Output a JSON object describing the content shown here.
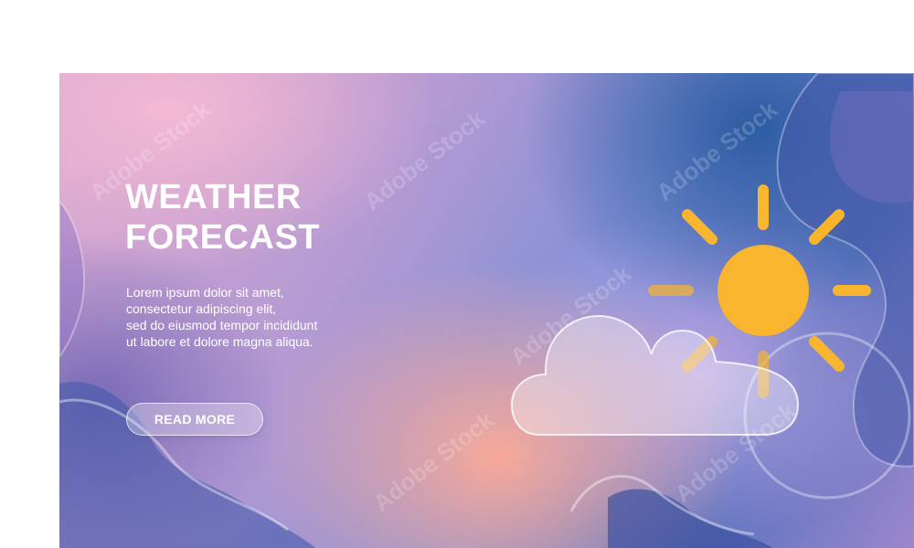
{
  "banner": {
    "title_lines": [
      "WEATHER",
      "FORECAST"
    ],
    "description_lines": [
      "Lorem ipsum dolor sit amet,",
      "consectetur adipiscing elit,",
      "sed do eiusmod tempor incididunt",
      "ut labore et dolore magna aliqua."
    ],
    "button_label": "READ MORE",
    "watermark_text": "Adobe Stock"
  },
  "illustration": {
    "icon": "sun-behind-cloud-icon",
    "sun_color": "#f8b52d",
    "cloud_color": "rgba(255,255,255,0.35)"
  },
  "colors": {
    "pink": "#f6bad4",
    "peach": "#ffaa96",
    "blue": "#285aa0",
    "purple": "#6e64b4",
    "white": "#ffffff"
  }
}
